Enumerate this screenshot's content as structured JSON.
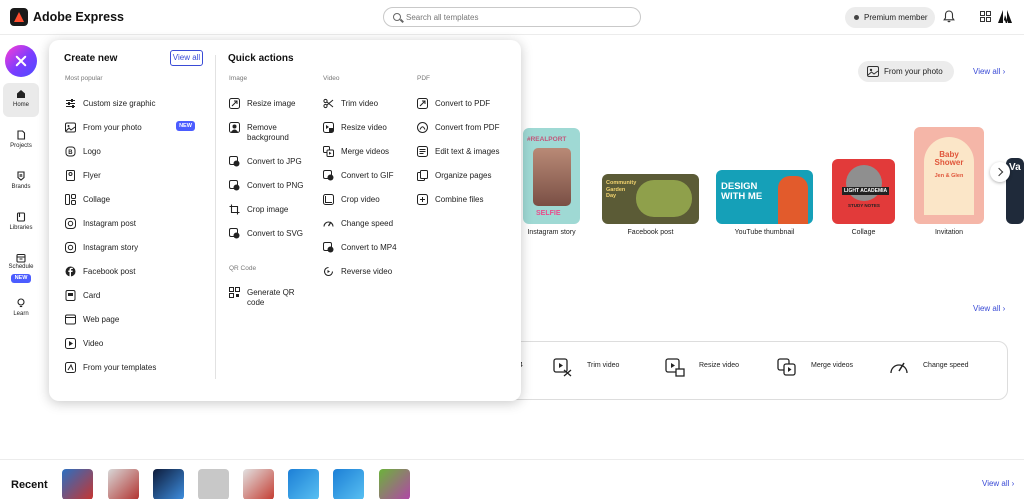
{
  "app": {
    "title": "Adobe Express"
  },
  "header": {
    "search_placeholder": "Search all templates",
    "premium_label": "Premium member"
  },
  "rail": {
    "items": [
      {
        "label": "Home"
      },
      {
        "label": "Projects"
      },
      {
        "label": "Brands"
      },
      {
        "label": "Libraries"
      },
      {
        "label": "Schedule"
      },
      {
        "label": "Learn"
      }
    ],
    "schedule_badge": "NEW"
  },
  "background": {
    "from_photo_button": "From your photo",
    "view_all_1": "View all",
    "view_all_2": "View all",
    "templates": [
      {
        "label": "Instagram story"
      },
      {
        "label": "Facebook post"
      },
      {
        "label": "YouTube thumbnail"
      },
      {
        "label": "Collage"
      },
      {
        "label": "Invitation"
      }
    ],
    "thumb_texts": {
      "instagram_top": "#REALPORT",
      "instagram_bottom": "SELFIE",
      "facebook": "Community Garden Day",
      "youtube": "DESIGN WITH ME",
      "collage": "LIGHT ACADEMIA",
      "collage_sub": "STUDY NOTES",
      "invitation_title": "Baby Shower",
      "invitation_names": "Jen & Glen",
      "edge_text": "Va"
    },
    "quick_actions_strip": [
      {
        "label": "4"
      },
      {
        "label": "Trim video"
      },
      {
        "label": "Resize video"
      },
      {
        "label": "Merge videos"
      },
      {
        "label": "Change speed"
      }
    ]
  },
  "recent": {
    "title": "Recent",
    "view_all": "View all"
  },
  "menu": {
    "create_new_title": "Create new",
    "view_all": "View all",
    "most_popular_label": "Most popular",
    "create_items": [
      {
        "label": "Custom size graphic"
      },
      {
        "label": "From your photo"
      },
      {
        "label": "Logo"
      },
      {
        "label": "Flyer"
      },
      {
        "label": "Collage"
      },
      {
        "label": "Instagram post"
      },
      {
        "label": "Instagram story"
      },
      {
        "label": "Facebook post"
      },
      {
        "label": "Card"
      },
      {
        "label": "Web page"
      },
      {
        "label": "Video"
      },
      {
        "label": "From your templates"
      }
    ],
    "new_badge": "NEW",
    "quick_actions_title": "Quick actions",
    "image_label": "Image",
    "image_items": [
      {
        "label": "Resize image"
      },
      {
        "label": "Remove background"
      },
      {
        "label": "Convert to JPG"
      },
      {
        "label": "Convert to PNG"
      },
      {
        "label": "Crop image"
      },
      {
        "label": "Convert to SVG"
      }
    ],
    "qr_label": "QR Code",
    "qr_items": [
      {
        "label": "Generate QR code"
      }
    ],
    "video_label": "Video",
    "video_items": [
      {
        "label": "Trim video"
      },
      {
        "label": "Resize video"
      },
      {
        "label": "Merge videos"
      },
      {
        "label": "Convert to GIF"
      },
      {
        "label": "Crop video"
      },
      {
        "label": "Change speed"
      },
      {
        "label": "Convert to MP4"
      },
      {
        "label": "Reverse video"
      }
    ],
    "pdf_label": "PDF",
    "pdf_items": [
      {
        "label": "Convert to PDF"
      },
      {
        "label": "Convert from PDF"
      },
      {
        "label": "Edit text & images"
      },
      {
        "label": "Organize pages"
      },
      {
        "label": "Combine files"
      }
    ]
  },
  "colors": {
    "accent_blue": "#3a4bd6",
    "badge_blue": "#4b5cff",
    "fab_gradient_start": "#ff3bd4",
    "fab_gradient_end": "#4c4cff"
  }
}
